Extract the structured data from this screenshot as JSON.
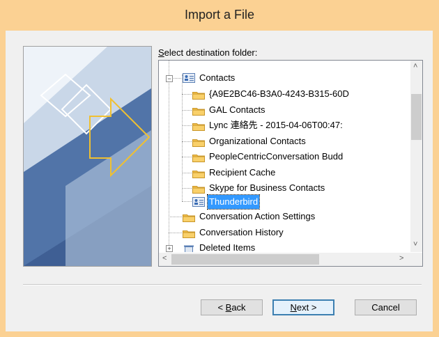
{
  "window": {
    "title": "Import a File"
  },
  "destination": {
    "label_prefix": "",
    "label_accel": "S",
    "label_rest": "elect destination folder:"
  },
  "tree": {
    "items": [
      {
        "label": "Contacts",
        "icon": "contact-card-icon",
        "level": 1,
        "expanded": true
      },
      {
        "label": "{A9E2BC46-B3A0-4243-B315-60D",
        "icon": "folder-icon",
        "level": 2
      },
      {
        "label": "GAL Contacts",
        "icon": "folder-icon",
        "level": 2
      },
      {
        "label": "Lync 連絡先 - 2015-04-06T00:47:",
        "icon": "folder-icon",
        "level": 2
      },
      {
        "label": "Organizational Contacts",
        "icon": "folder-icon",
        "level": 2
      },
      {
        "label": "PeopleCentricConversation Budd",
        "icon": "folder-icon",
        "level": 2
      },
      {
        "label": "Recipient Cache",
        "icon": "folder-icon",
        "level": 2
      },
      {
        "label": "Skype for Business Contacts",
        "icon": "folder-icon",
        "level": 2
      },
      {
        "label": "Thunderbird",
        "icon": "contact-card-icon",
        "level": 2,
        "selected": true
      },
      {
        "label": "Conversation Action Settings",
        "icon": "folder-icon",
        "level": 1
      },
      {
        "label": "Conversation History",
        "icon": "folder-icon",
        "level": 1
      },
      {
        "label": "Deleted Items",
        "icon": "trash-icon",
        "level": 1
      }
    ]
  },
  "scroll": {
    "up_arrow": "˄",
    "down_arrow": "˅",
    "left_arrow": "<",
    "right_arrow": ">"
  },
  "buttons": {
    "back_prefix": "< ",
    "back_accel": "B",
    "back_rest": "ack",
    "next_accel": "N",
    "next_rest": "ext >",
    "cancel": "Cancel"
  },
  "colors": {
    "titlebar": "#fbd193",
    "selection": "#3399ff",
    "folder": "#f5c04a",
    "side_image": "#2d4778"
  }
}
